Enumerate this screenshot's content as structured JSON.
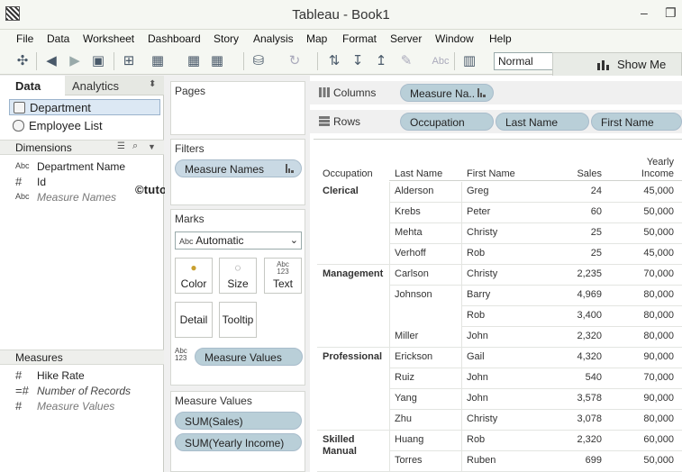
{
  "window": {
    "title": "Tableau - Book1",
    "minimize": "–",
    "restore": "❐"
  },
  "menu": [
    "File",
    "Data",
    "Worksheet",
    "Dashboard",
    "Story",
    "Analysis",
    "Map",
    "Format",
    "Server",
    "Window",
    "Help"
  ],
  "toolbar": {
    "fit_value": "Normal",
    "show_me_label": "Show Me",
    "abc_label": "Abc"
  },
  "left": {
    "tabs": {
      "data": "Data",
      "analytics": "Analytics"
    },
    "datasources": [
      "Department",
      "Employee List"
    ],
    "dimensions_label": "Dimensions",
    "dimensions": [
      {
        "type": "Abc",
        "name": "Department Name",
        "style": "normal"
      },
      {
        "type": "#",
        "name": "Id",
        "style": "normal"
      },
      {
        "type": "Abc",
        "name": "Measure Names",
        "style": "grey"
      }
    ],
    "measures_label": "Measures",
    "measures": [
      {
        "type": "#",
        "name": "Hike Rate",
        "style": "normal"
      },
      {
        "type": "=#",
        "name": "Number of Records",
        "style": "italic"
      },
      {
        "type": "#",
        "name": "Measure Values",
        "style": "grey"
      }
    ]
  },
  "watermark": "©tutorialgateway.org",
  "shelves": {
    "pages_label": "Pages",
    "filters_label": "Filters",
    "filters": [
      "Measure Names"
    ],
    "marks_label": "Marks",
    "mark_type": "Automatic",
    "mark_type_icon": "Abc",
    "mark_buttons": [
      "Color",
      "Size",
      "Text",
      "Detail",
      "Tooltip"
    ],
    "text_glyph": {
      "line1": "Abc",
      "line2": "123"
    },
    "marks_pill": "Measure Values",
    "mv_label": "Measure Values",
    "mv_pills": [
      "SUM(Sales)",
      "SUM(Yearly Income)"
    ],
    "columns_label": "Columns",
    "columns": [
      "Measure Na.."
    ],
    "rows_label": "Rows",
    "rows": [
      "Occupation",
      "Last Name",
      "First Name"
    ]
  },
  "table": {
    "headers": {
      "occupation": "Occupation",
      "last": "Last Name",
      "first": "First Name",
      "sales": "Sales",
      "income_1": "Yearly",
      "income_2": "Income"
    },
    "groups": [
      {
        "occupation": "Clerical",
        "rows": [
          {
            "last": "Alderson",
            "first": "Greg",
            "sales": "24",
            "income": "45,000"
          },
          {
            "last": "Krebs",
            "first": "Peter",
            "sales": "60",
            "income": "50,000"
          },
          {
            "last": "Mehta",
            "first": "Christy",
            "sales": "25",
            "income": "50,000"
          },
          {
            "last": "Verhoff",
            "first": "Rob",
            "sales": "25",
            "income": "45,000"
          }
        ]
      },
      {
        "occupation": "Management",
        "rows": [
          {
            "last": "Carlson",
            "first": "Christy",
            "sales": "2,235",
            "income": "70,000"
          },
          {
            "last": "Johnson",
            "first": "Barry",
            "sales": "4,969",
            "income": "80,000"
          },
          {
            "last": "",
            "first": "Rob",
            "sales": "3,400",
            "income": "80,000"
          },
          {
            "last": "Miller",
            "first": "John",
            "sales": "2,320",
            "income": "80,000"
          }
        ]
      },
      {
        "occupation": "Professional",
        "rows": [
          {
            "last": "Erickson",
            "first": "Gail",
            "sales": "4,320",
            "income": "90,000"
          },
          {
            "last": "Ruiz",
            "first": "John",
            "sales": "540",
            "income": "70,000"
          },
          {
            "last": "Yang",
            "first": "John",
            "sales": "3,578",
            "income": "90,000"
          },
          {
            "last": "Zhu",
            "first": "Christy",
            "sales": "3,078",
            "income": "80,000"
          }
        ]
      },
      {
        "occupation": "Skilled Manual",
        "occupation_l1": "Skilled",
        "occupation_l2": "Manual",
        "rows": [
          {
            "last": "Huang",
            "first": "Rob",
            "sales": "2,320",
            "income": "60,000"
          },
          {
            "last": "Torres",
            "first": "Ruben",
            "sales": "699",
            "income": "50,000"
          }
        ]
      }
    ]
  }
}
